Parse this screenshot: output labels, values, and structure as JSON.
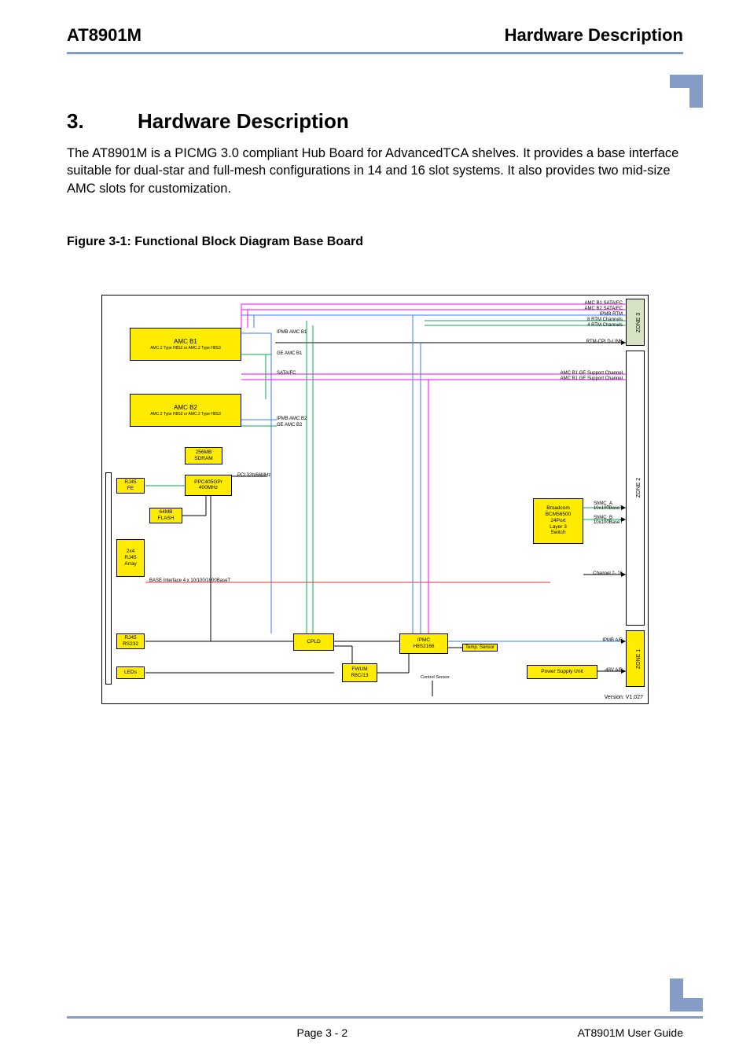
{
  "header": {
    "left": "AT8901M",
    "right": "Hardware Description"
  },
  "chapter": {
    "num": "3.",
    "title": "Hardware Description"
  },
  "body": "The AT8901M is a PICMG 3.0 compliant Hub Board for AdvancedTCA shelves. It provides a base interface suitable for dual-star and full-mesh configurations in 14 and 16 slot systems. It also provides two mid-size AMC slots for customization.",
  "figure_caption": "Figure 3-1:  Functional Block Diagram Base Board",
  "diagram": {
    "blocks": {
      "amc_b1": {
        "title": "AMC B1",
        "sub": "AMC.2 Type H8S2 or AMC.2 Type H8S3"
      },
      "amc_b2": {
        "title": "AMC B2",
        "sub": "AMC.2 Type H8S2 or AMC.2 Type H8S3"
      },
      "sdram": {
        "l1": "256MB",
        "l2": "SDRAM"
      },
      "ppc": {
        "l1": "PPC405GPr",
        "l2": "400MHz"
      },
      "flash": {
        "l1": "64MB",
        "l2": "FLASH"
      },
      "rj45fe": {
        "l1": "RJ45",
        "l2": "FE"
      },
      "rj45arr": {
        "l1": "2x4",
        "l2": "RJ45",
        "l3": "Array"
      },
      "rj45rs": {
        "l1": "RJ45",
        "l2": "RS232"
      },
      "leds": "LEDs",
      "cpld": "CPLD",
      "fwum": {
        "l1": "FWUM",
        "l2": "R8C/13"
      },
      "ipmc": {
        "l1": "IPMC",
        "l2": "H8S2166"
      },
      "psu": "Power Supply Unit",
      "bcm": {
        "l1": "Broadcom",
        "l2": "BCM56500",
        "l3": "24Port",
        "l4": "Layer 3",
        "l5": "Switch"
      },
      "temp_sensor": "Temp.\nSensor",
      "control_sensor": "Control\nSensor"
    },
    "labels": {
      "ipmb_amc_b1": "IPMB AMC B1",
      "ge_amc_b1": "GE AMC B1",
      "sata_fc": "SATA/FC",
      "ipmb_amc_b2": "IPMB AMC B2",
      "ge_amc_b2": "GE AMC B2",
      "pci": "PCI 32b/66MHz",
      "base_if": "BASE Interface 4 x 10/100/1000BaseT",
      "amc_b1_sata": "AMC B1 SATA/FC",
      "amc_b2_sata": "AMC B2 SATA/FC",
      "ipmb_rtm": "IPMB RTM",
      "rtm_ch8": "8 RTM Channels",
      "rtm_ch4": "4 RTM Channels",
      "rtm_cpld": "RTM-CPLD-LINK",
      "amc_b1_ge": "AMC B1 GE Support Channel",
      "amc_b2_ge": "AMC B1 GE Support Channel",
      "shmc_a": "ShMC_A\n10x100BaseT",
      "shmc_b": "ShMC_B\n10x100BaseT",
      "ch2_16": "Channel 2- 16",
      "ipmb_ab": "IPMB A/B",
      "v48": "-48V A/B"
    },
    "zones": {
      "z1": "ZONE 1",
      "z2": "ZONE 2",
      "z3": "ZONE 3"
    },
    "version": "Version: V1.027"
  },
  "footer": {
    "page": "Page 3 - 2",
    "guide": "AT8901M User Guide"
  }
}
